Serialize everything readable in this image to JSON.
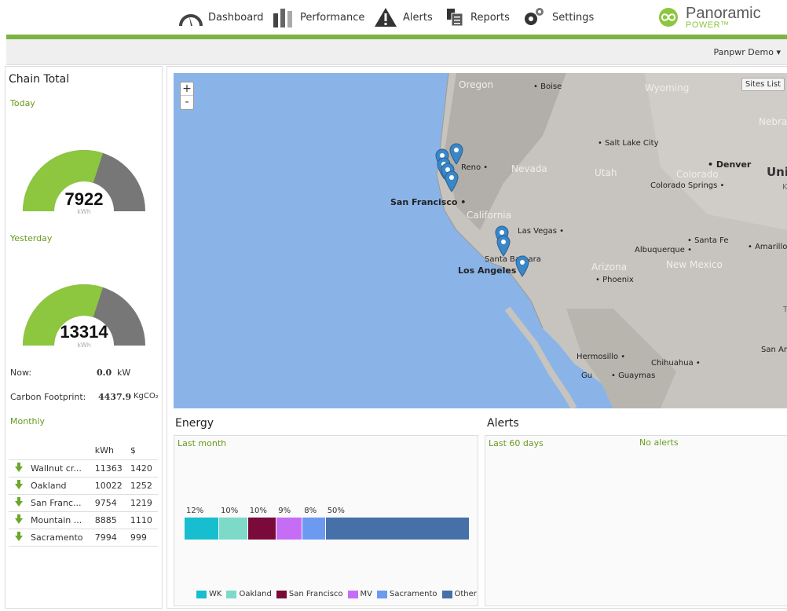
{
  "nav": {
    "items": [
      {
        "label": "Dashboard",
        "icon": "gauge-icon"
      },
      {
        "label": "Performance",
        "icon": "bars-icon"
      },
      {
        "label": "Alerts",
        "icon": "warning-icon"
      },
      {
        "label": "Reports",
        "icon": "reports-icon"
      },
      {
        "label": "Settings",
        "icon": "gear-icon"
      }
    ],
    "brand": {
      "name": "Panoramic",
      "sub": "POWER™"
    }
  },
  "colors": {
    "accent": "#7cb342",
    "gauge_fill": "#8dc63f",
    "gauge_bg": "#777777",
    "map_water": "#8ab4e8",
    "marker": "#3a87c8"
  },
  "user_menu": "Panpwr Demo ▾",
  "chain": {
    "title": "Chain Total",
    "today": {
      "label": "Today",
      "value": "7922",
      "unit": "kWh",
      "fraction": 0.6
    },
    "yesterday": {
      "label": "Yesterday",
      "value": "13314",
      "unit": "kWh",
      "fraction": 0.6
    },
    "now": {
      "label": "Now:",
      "value": "0.0",
      "unit": "kW"
    },
    "carbon": {
      "label": "Carbon Footprint:",
      "value": "4437.9",
      "unit": "KgCO₂"
    },
    "monthly": {
      "label": "Monthly",
      "headers": [
        "",
        "",
        "kWh",
        "$"
      ],
      "rows": [
        {
          "name": "Wallnut cr...",
          "kwh": "11363",
          "usd": "1420"
        },
        {
          "name": "Oakland",
          "kwh": "10022",
          "usd": "1252"
        },
        {
          "name": "San Franc...",
          "kwh": "9754",
          "usd": "1219"
        },
        {
          "name": "Mountain ...",
          "kwh": "8885",
          "usd": "1110"
        },
        {
          "name": "Sacramento",
          "kwh": "7994",
          "usd": "999"
        }
      ]
    }
  },
  "map": {
    "zoom_in": "+",
    "zoom_out": "-",
    "sites_list": "Sites List",
    "labels": {
      "oregon": "Oregon",
      "boise": "• Boise",
      "wyoming": "Wyoming",
      "nebraska": "Nebras",
      "saltlake": "• Salt Lake City",
      "reno": "Reno •",
      "nevada": "Nevada",
      "utah": "Utah",
      "denver": "• Denver",
      "colorado": "Colorado",
      "coloradosprings": "Colorado Springs •",
      "uni": "Uni",
      "k": "K",
      "sanfrancisco": "San Francisco •",
      "california": "California",
      "lasvegas": "Las Vegas •",
      "santafe": "• Santa Fe",
      "amarillo": "• Amarillo",
      "albuquerque": "Albuquerque •",
      "santabarbara": "Santa Barbara",
      "arizona": "Arizona",
      "newmexico": "New Mexico",
      "losangeles": "Los Angeles •",
      "phoenix": "• Phoenix",
      "t": "T",
      "sananto": "San Anto",
      "hermosillo": "Hermosillo •",
      "chihuahua": "Chihuahua •",
      "gu": "Gu",
      "guaymas": "• Guaymas"
    }
  },
  "energy": {
    "title": "Energy",
    "period": "Last month",
    "segments": [
      {
        "name": "WK",
        "pct": 12,
        "label": "12%",
        "color": "#17becf"
      },
      {
        "name": "Oakland",
        "pct": 10,
        "label": "10%",
        "color": "#7dd9c8"
      },
      {
        "name": "San Francisco",
        "pct": 10,
        "label": "10%",
        "color": "#7a0a3a"
      },
      {
        "name": "MV",
        "pct": 9,
        "label": "9%",
        "color": "#c66df5"
      },
      {
        "name": "Sacramento",
        "pct": 8,
        "label": "8%",
        "color": "#6b9af0"
      },
      {
        "name": "Other",
        "pct": 50,
        "label": "50%",
        "color": "#4670a8"
      }
    ]
  },
  "alerts": {
    "title": "Alerts",
    "period": "Last 60 days",
    "empty": "No alerts"
  }
}
